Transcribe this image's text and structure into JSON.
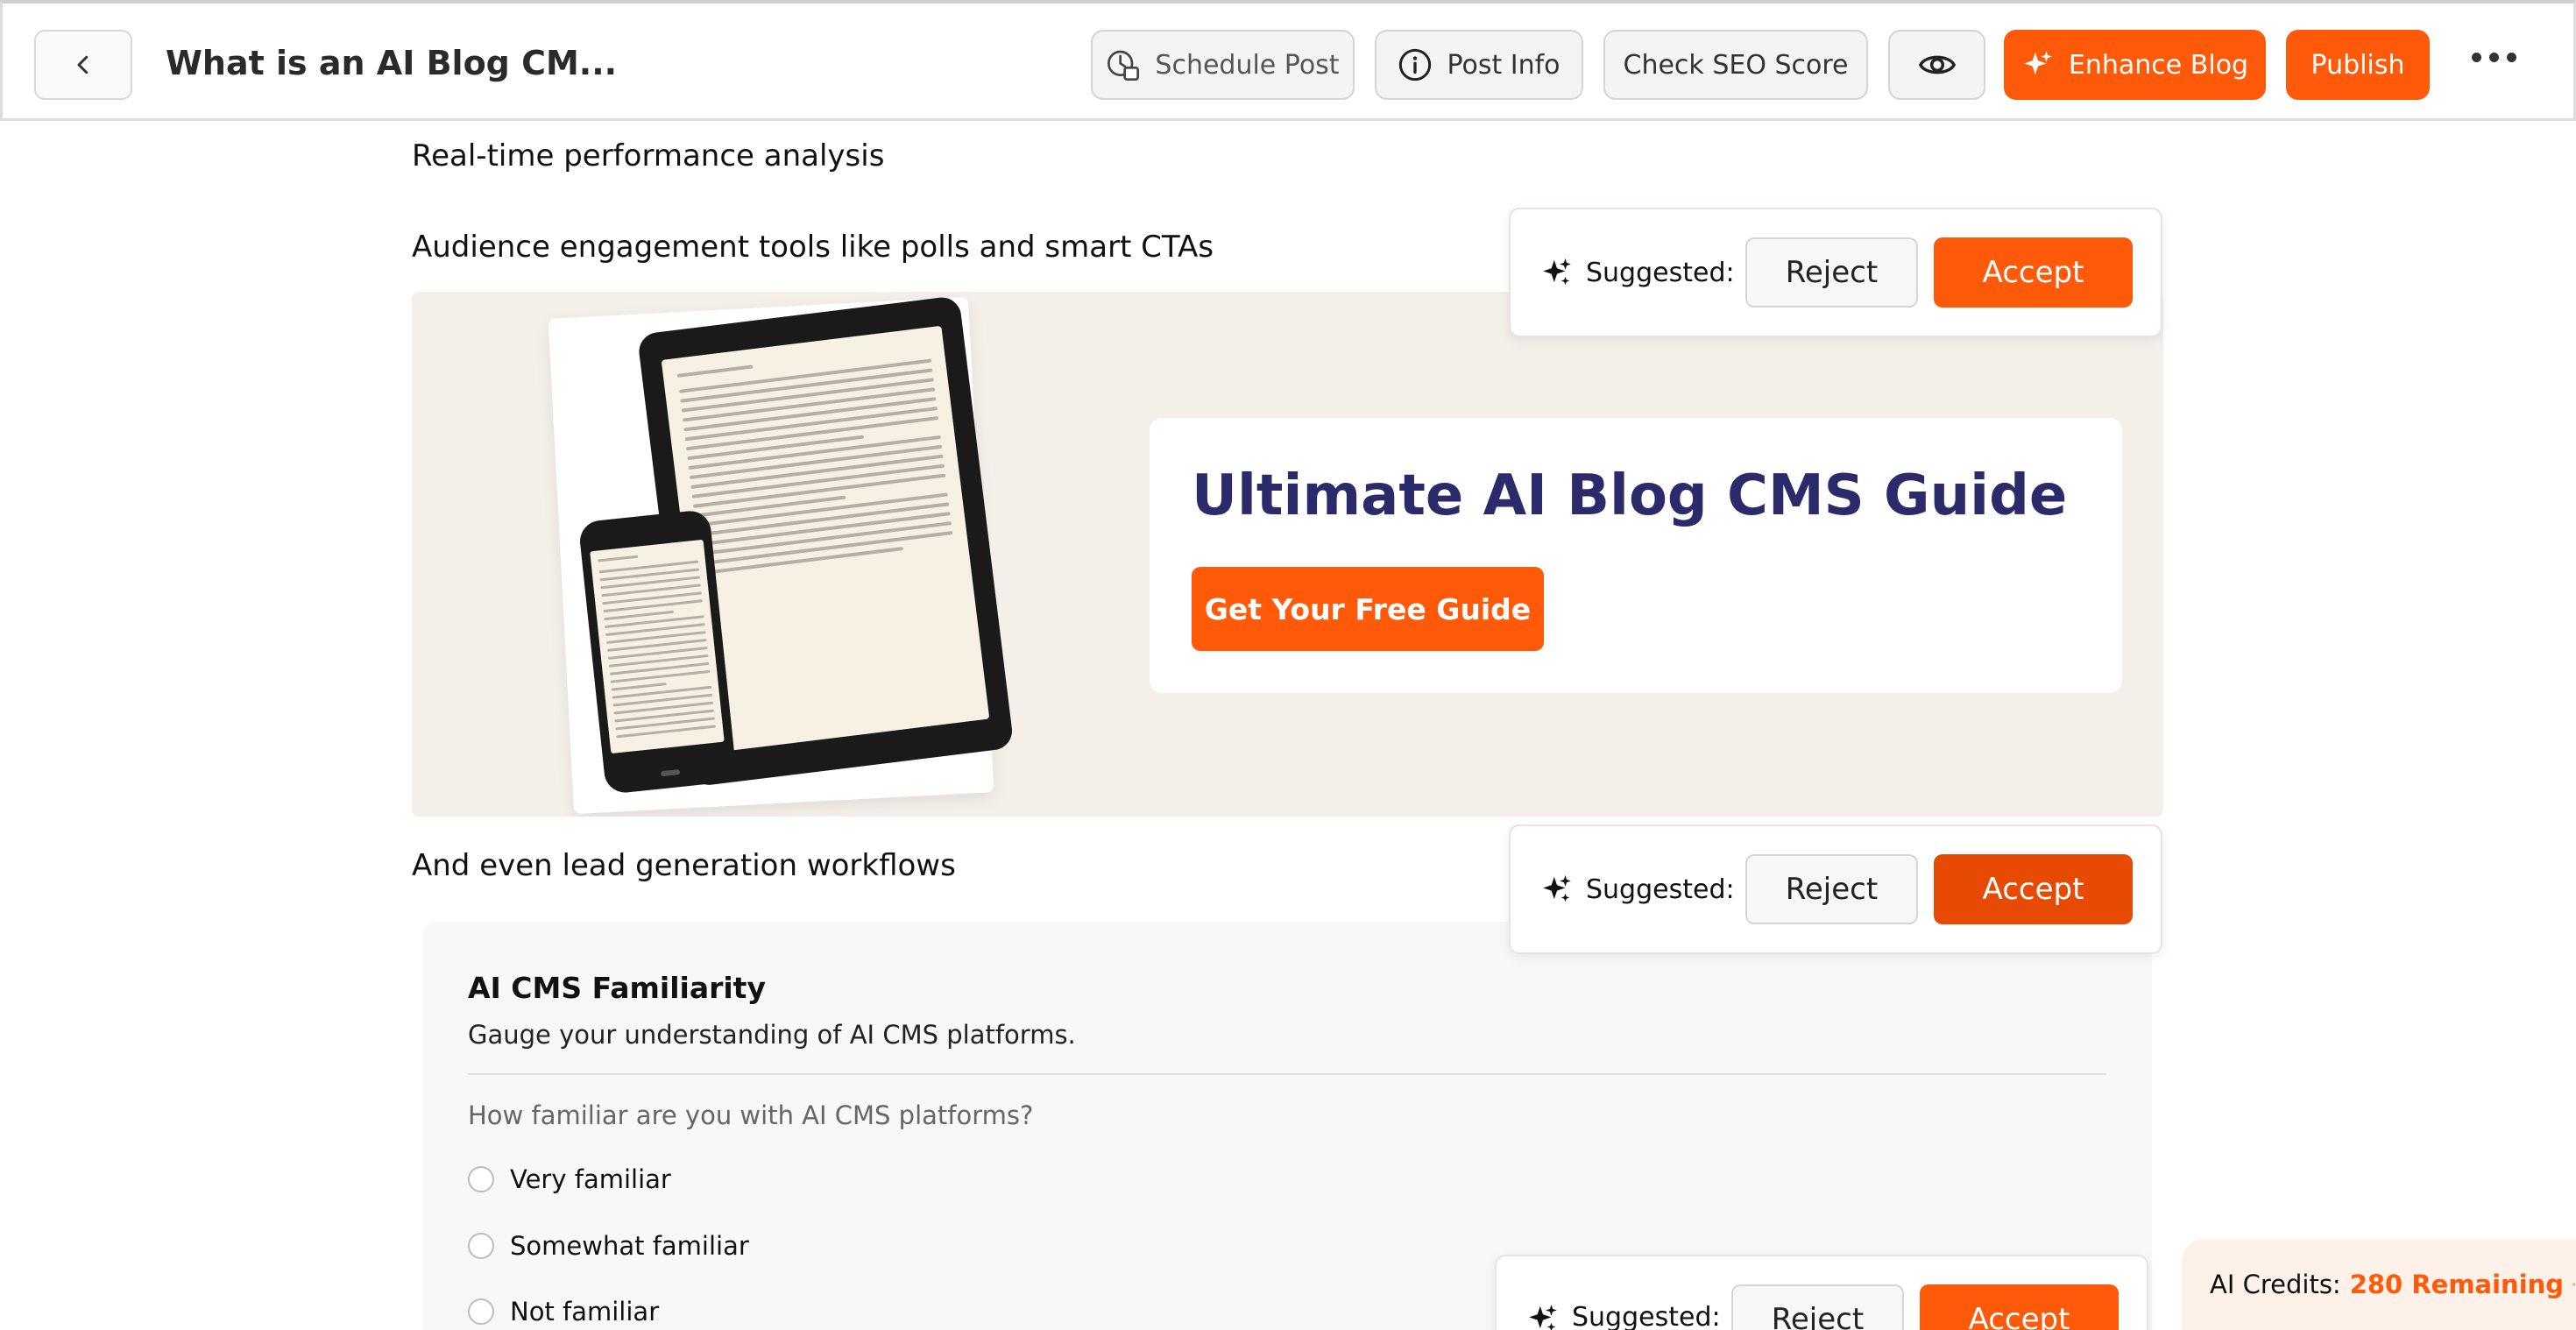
{
  "header": {
    "back_icon": "chevron-left-icon",
    "title": "What is an AI Blog CM...",
    "schedule_label": "Schedule Post",
    "post_info_label": "Post Info",
    "seo_label": "Check SEO Score",
    "enhance_label": "Enhance Blog",
    "publish_label": "Publish",
    "more_icon": "more-horizontal-icon",
    "accent_color": "#ff5a0a"
  },
  "content": {
    "line1": "Real-time performance analysis",
    "line2": "Audience engagement tools like polls and smart CTAs",
    "line3": "And even lead generation workflows"
  },
  "banner": {
    "title": "Ultimate AI Blog CMS Guide",
    "cta_label": "Get Your Free Guide",
    "title_color": "#2b2b6b",
    "background": "#f5efea"
  },
  "suggestions": [
    {
      "label": "Suggested:",
      "reject": "Reject",
      "accept": "Accept"
    },
    {
      "label": "Suggested:",
      "reject": "Reject",
      "accept": "Accept"
    },
    {
      "label": "Suggested:",
      "reject": "Reject",
      "accept": "Accept"
    }
  ],
  "poll": {
    "title": "AI CMS Familiarity",
    "description": "Gauge your understanding of AI CMS platforms.",
    "question": "How familiar are you with AI CMS platforms?",
    "options": [
      "Very familiar",
      "Somewhat familiar",
      "Not familiar"
    ]
  },
  "credits": {
    "label": "AI Credits:",
    "value": "280 Remaining",
    "icon": "coins-icon"
  }
}
